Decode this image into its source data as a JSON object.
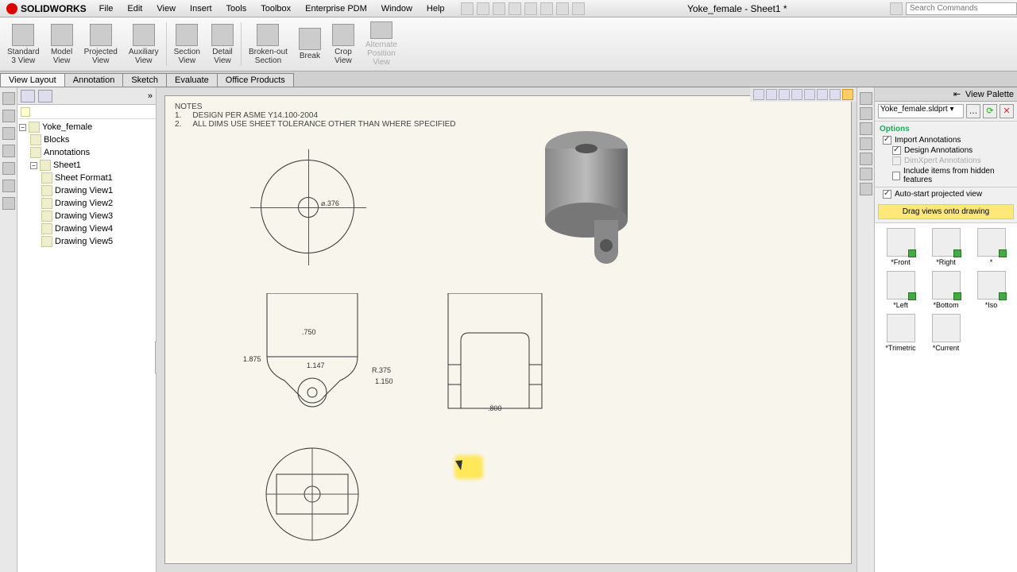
{
  "app": {
    "name": "SOLIDWORKS",
    "doc_title": "Yoke_female - Sheet1 *"
  },
  "menu": [
    "File",
    "Edit",
    "View",
    "Insert",
    "Tools",
    "Toolbox",
    "Enterprise PDM",
    "Window",
    "Help"
  ],
  "search_placeholder": "Search Commands",
  "ribbon": [
    {
      "label": "Standard\n3 View"
    },
    {
      "label": "Model\nView"
    },
    {
      "label": "Projected\nView"
    },
    {
      "label": "Auxiliary\nView"
    },
    {
      "label": "Section\nView"
    },
    {
      "label": "Detail\nView"
    },
    {
      "label": "Broken-out\nSection"
    },
    {
      "label": "Break"
    },
    {
      "label": "Crop\nView"
    },
    {
      "label": "Alternate\nPosition\nView",
      "disabled": true
    }
  ],
  "tabs": [
    "View Layout",
    "Annotation",
    "Sketch",
    "Evaluate",
    "Office Products"
  ],
  "active_tab": 0,
  "tree": {
    "root": "Yoke_female",
    "children": [
      {
        "label": "Blocks"
      },
      {
        "label": "Annotations"
      },
      {
        "label": "Sheet1",
        "expanded": true,
        "children": [
          {
            "label": "Sheet Format1"
          },
          {
            "label": "Drawing View1"
          },
          {
            "label": "Drawing View2"
          },
          {
            "label": "Drawing View3"
          },
          {
            "label": "Drawing View4"
          },
          {
            "label": "Drawing View5"
          }
        ]
      }
    ]
  },
  "notes": {
    "heading": "NOTES",
    "lines": [
      {
        "num": "1.",
        "text": "DESIGN PER ASME Y14.100-2004"
      },
      {
        "num": "2.",
        "text": "ALL DIMS USE SHEET TOLERANCE OTHER THAN WHERE SPECIFIED"
      }
    ]
  },
  "dimensions": {
    "top_dia": "⌀.376",
    "front_width": ".750",
    "front_height": "1.875",
    "front_r1": "1.147",
    "front_r2": "R.375",
    "front_h2": "1.150",
    "right_width": ".800"
  },
  "palette": {
    "title": "View Palette",
    "model": "Yoke_female.sldprt",
    "options_title": "Options",
    "opts": [
      {
        "label": "Import Annotations",
        "checked": true
      },
      {
        "label": "Design Annotations",
        "checked": true,
        "indent": true
      },
      {
        "label": "DimXpert Annotations",
        "checked": false,
        "indent": true,
        "disabled": true
      },
      {
        "label": "Include items from hidden features",
        "checked": false,
        "indent": true
      }
    ],
    "autostart": {
      "label": "Auto-start projected view",
      "checked": true
    },
    "hint": "Drag views onto drawing",
    "thumbs": [
      "*Front",
      "*Right",
      "*",
      "*Left",
      "*Bottom",
      "*Iso",
      "*Trimetric",
      "*Current"
    ]
  }
}
